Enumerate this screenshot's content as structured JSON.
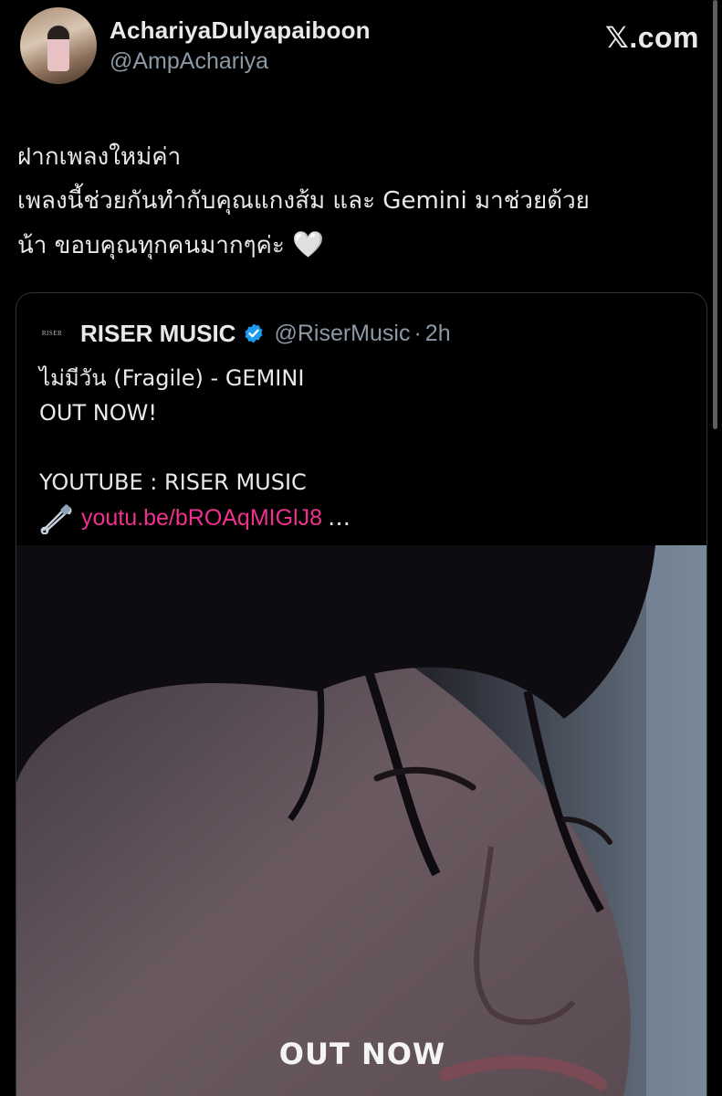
{
  "author": {
    "display_name": "AchariyaDulyapaiboon",
    "handle": "@AmpAchariya"
  },
  "site": {
    "mark": "𝕏",
    "domain": ".com"
  },
  "tweet": {
    "lines": [
      "ฝากเพลงใหม่ค่า",
      "เพลงนี้ช่วยกันทำกับคุณแกงส้ม และ Gemini มาช่วยด้วย",
      "น้า  ขอบคุณทุกคนมากๆค่ะ"
    ],
    "emoji": "🤍"
  },
  "quoted": {
    "logo_text": "RISER",
    "name": "RISER MUSIC",
    "handle": "@RiserMusic",
    "dot": "·",
    "time": "2h",
    "body": [
      "ไม่มีวัน (Fragile) - GEMINI",
      "OUT NOW!",
      "",
      "YOUTUBE : RISER MUSIC"
    ],
    "link": "youtu.be/bROAqMIGlJ8",
    "ellipsis": "…",
    "media_caption": "OUT NOW"
  },
  "colors": {
    "background": "#000000",
    "text": "#e7e9ea",
    "secondary": "#8b98a5",
    "link": "#f0308f",
    "verified": "#1d9bf0"
  },
  "icons": [
    "verified-badge-icon",
    "safety-pin-icon",
    "x-logo-icon"
  ]
}
